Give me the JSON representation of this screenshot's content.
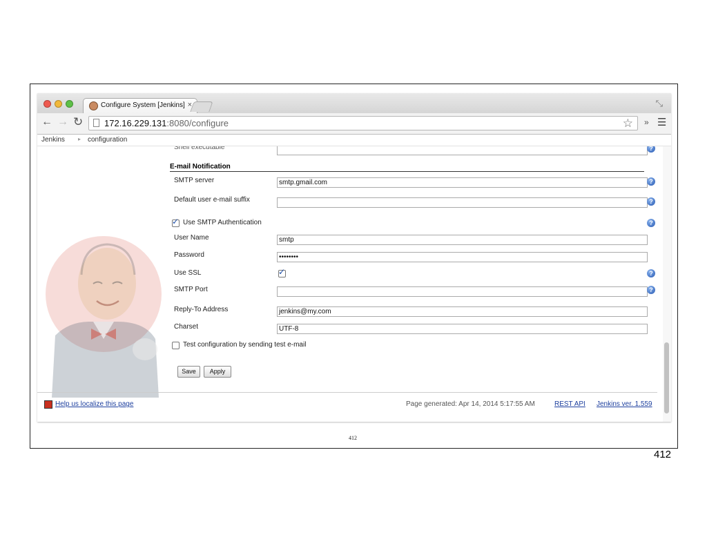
{
  "browser": {
    "tab_title": "Configure System [Jenkins]",
    "tab_close": "×",
    "url_host": "172.16.229.131",
    "url_rest": ":8080/configure",
    "extensions_glyph": "»"
  },
  "breadcrumb": {
    "root": "Jenkins",
    "current": "configuration"
  },
  "form": {
    "section_title": "E-mail Notification",
    "smtp_server_label": "SMTP server",
    "smtp_server_value": "smtp.gmail.com",
    "suffix_label": "Default user e-mail suffix",
    "suffix_value": "",
    "smtp_auth_label": "Use SMTP Authentication",
    "smtp_auth_checked": true,
    "username_label": "User Name",
    "username_value": "smtp",
    "password_label": "Password",
    "password_value": "••••••••",
    "ssl_label": "Use SSL",
    "ssl_checked": true,
    "port_label": "SMTP Port",
    "port_value": "",
    "reply_to_label": "Reply-To Address",
    "reply_to_value": "jenkins@my.com",
    "charset_label": "Charset",
    "charset_value": "UTF-8",
    "test_label": "Test configuration by sending test e-mail",
    "test_checked": false,
    "save_label": "Save",
    "apply_label": "Apply",
    "help_glyph": "?"
  },
  "footer": {
    "localize_link": "Help us localize this page",
    "page_generated": "Page generated: Apr 14, 2014 5:17:55 AM",
    "rest_api": "REST API",
    "version": "Jenkins ver. 1.559"
  },
  "slide": {
    "page_number_small": "412",
    "page_number": "412"
  },
  "colors": {
    "link": "#1d3f9e",
    "help_icon": "#2759b3",
    "close_light": "#ee5a50",
    "minimize_light": "#f1b83b",
    "maximize_light": "#5ec048"
  },
  "icons": [
    "back-arrow-icon",
    "forward-arrow-icon",
    "reload-icon",
    "page-icon",
    "star-icon",
    "menu-icon",
    "fullscreen-icon",
    "help-icon",
    "checkmark-icon",
    "jenkins-mascot"
  ]
}
